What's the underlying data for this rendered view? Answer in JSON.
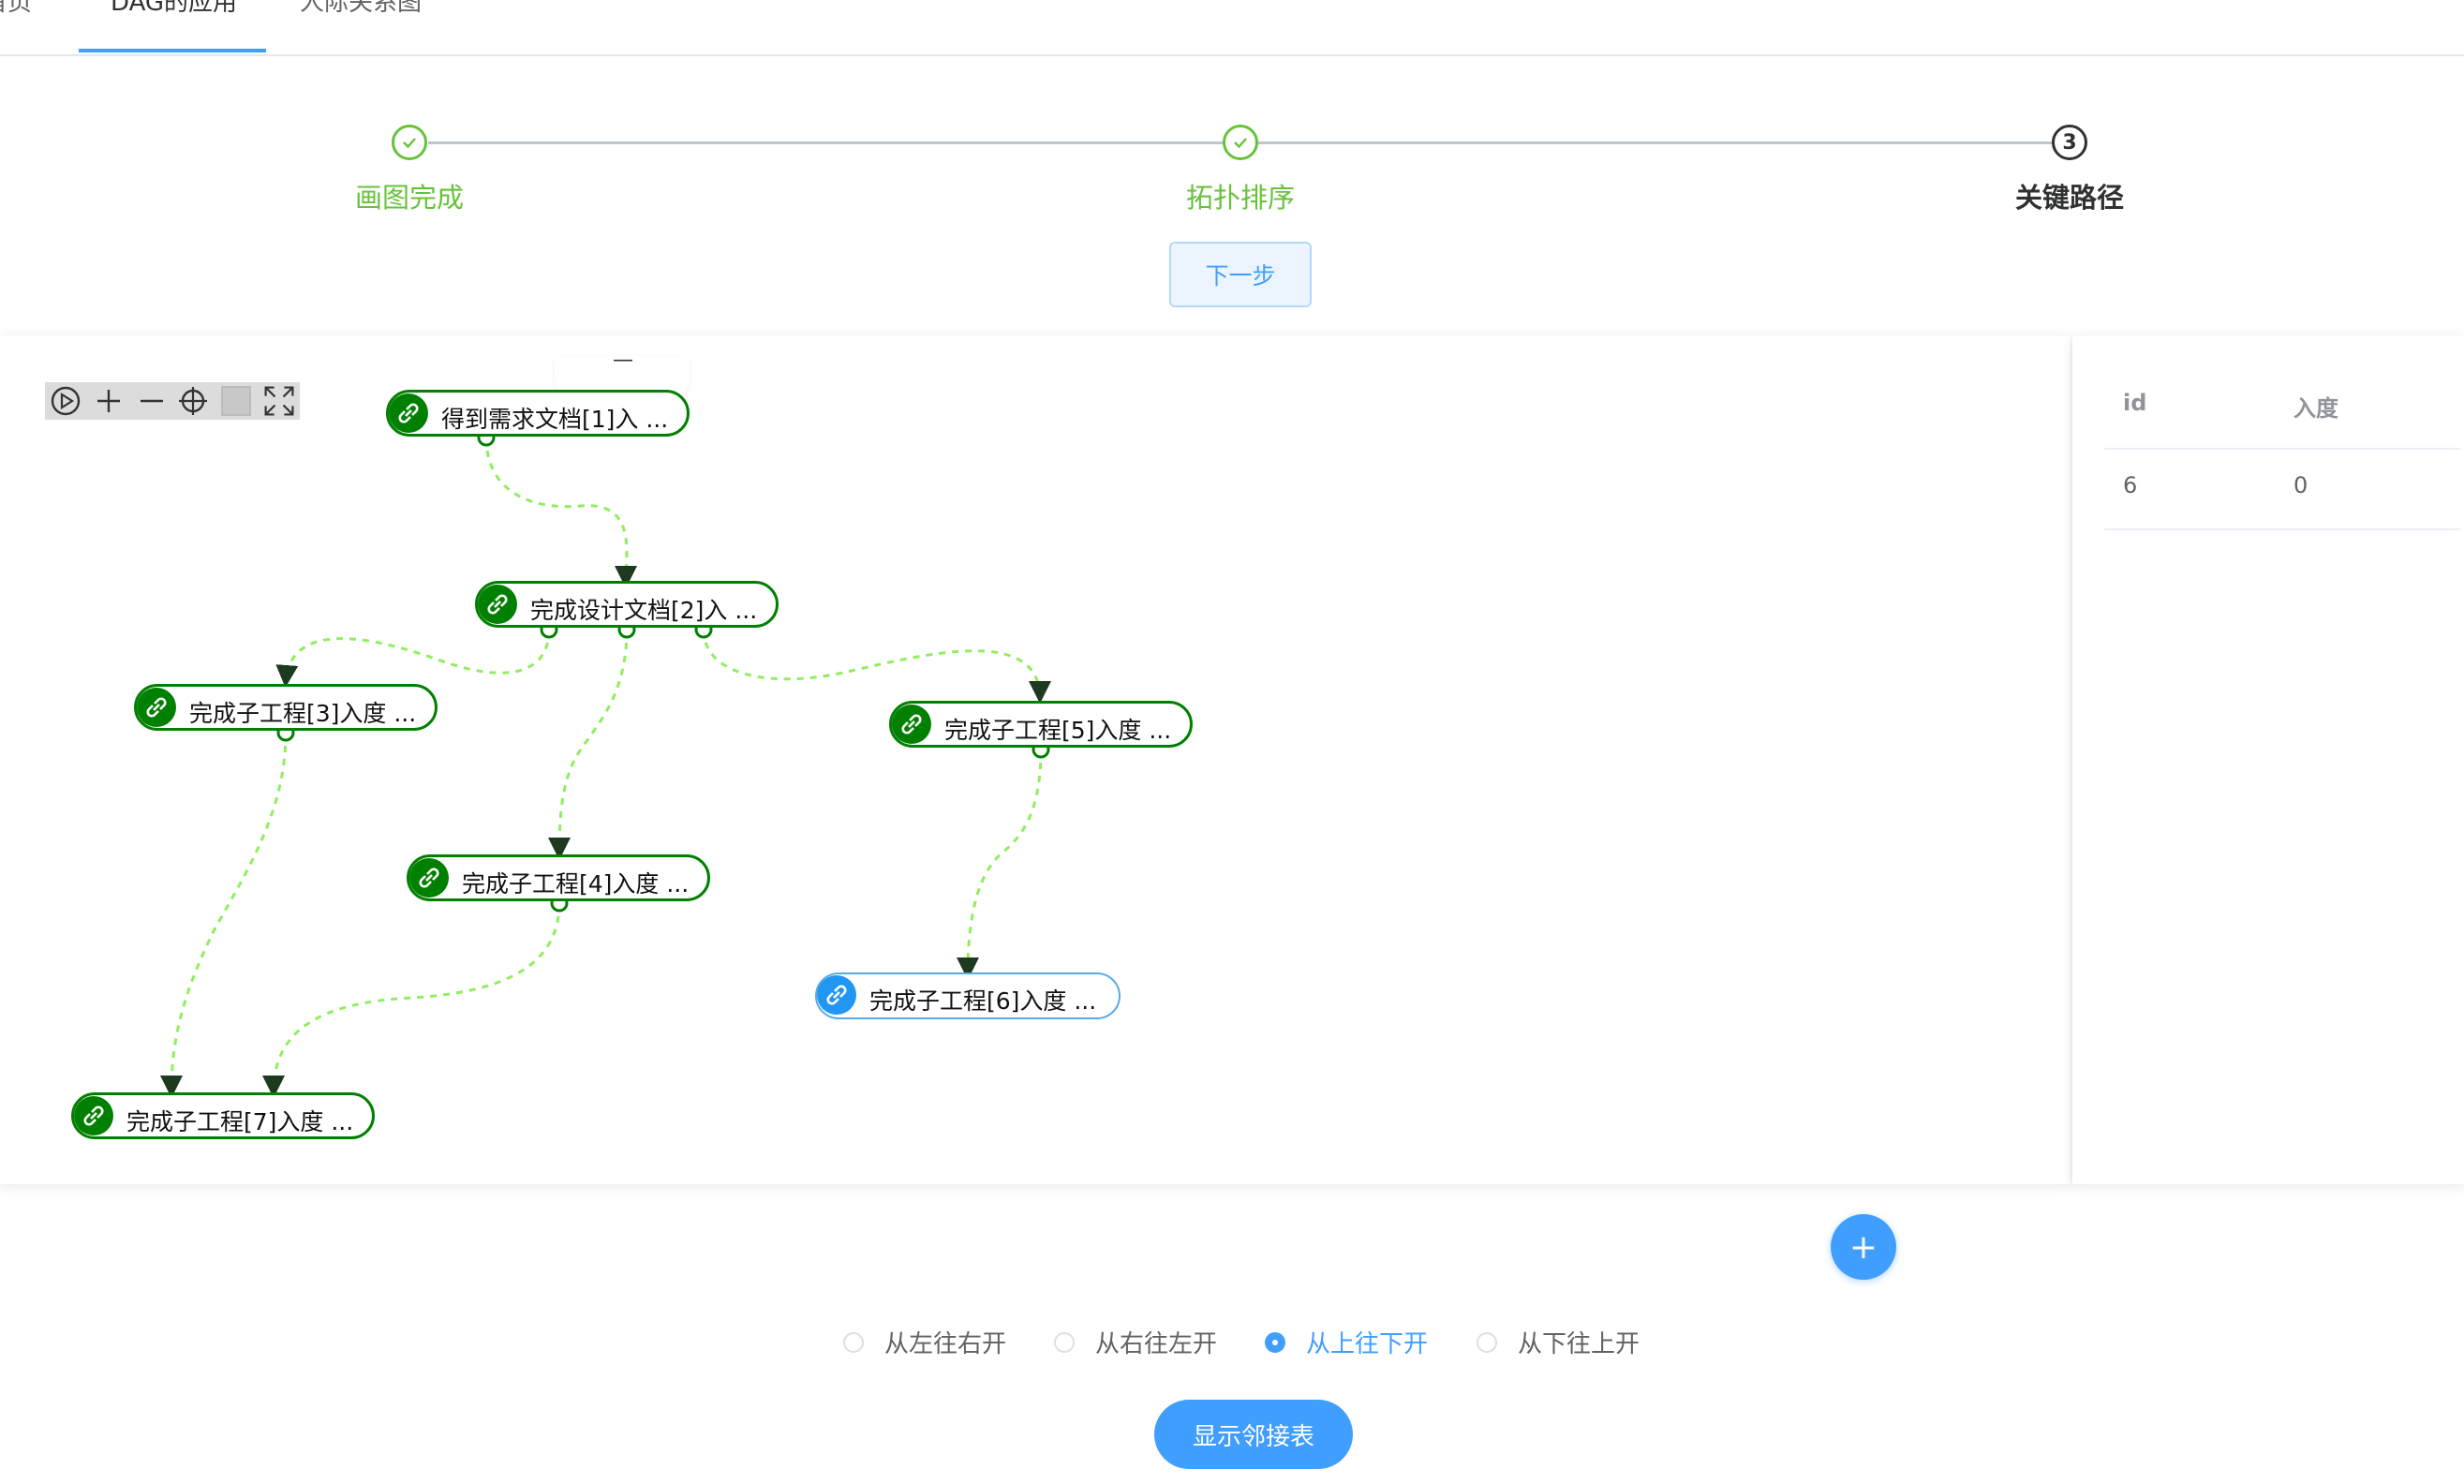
{
  "tabs": [
    {
      "label": "首页",
      "active": false
    },
    {
      "label": "DAG的应用",
      "active": true
    },
    {
      "label": "人际关系图",
      "active": false
    }
  ],
  "steps": [
    {
      "title": "画图完成",
      "status": "done",
      "icon": "check-icon"
    },
    {
      "title": "拓扑排序",
      "status": "done",
      "icon": "check-icon"
    },
    {
      "title": "关键路径",
      "status": "active",
      "number": "3"
    }
  ],
  "next_button": {
    "label": "下一步"
  },
  "toolbar": {
    "icons": [
      "play-icon",
      "zoom-in-icon",
      "zoom-out-icon",
      "locate-icon",
      "square-icon",
      "fullscreen-icon"
    ]
  },
  "graph": {
    "tooltip_text": "—",
    "nodes": [
      {
        "id": "1",
        "label": "得到需求文档[1]入 ...",
        "state": "done",
        "icon": "link-icon"
      },
      {
        "id": "2",
        "label": "完成设计文档[2]入 ...",
        "state": "done",
        "icon": "link-icon"
      },
      {
        "id": "3",
        "label": "完成子工程[3]入度 ...",
        "state": "done",
        "icon": "link-icon"
      },
      {
        "id": "4",
        "label": "完成子工程[4]入度 ...",
        "state": "done",
        "icon": "link-icon"
      },
      {
        "id": "5",
        "label": "完成子工程[5]入度 ...",
        "state": "done",
        "icon": "link-icon"
      },
      {
        "id": "6",
        "label": "完成子工程[6]入度 ...",
        "state": "current",
        "icon": "link-icon"
      },
      {
        "id": "7",
        "label": "完成子工程[7]入度 ...",
        "state": "done",
        "icon": "link-icon"
      }
    ],
    "edges": [
      [
        "1",
        "2"
      ],
      [
        "2",
        "3"
      ],
      [
        "2",
        "4"
      ],
      [
        "2",
        "5"
      ],
      [
        "3",
        "7"
      ],
      [
        "4",
        "7"
      ],
      [
        "5",
        "6"
      ]
    ],
    "colors": {
      "done": "#008000",
      "current": "#2196f3",
      "edge": "#90ee60"
    }
  },
  "table": {
    "headers": [
      "id",
      "入度"
    ],
    "rows": [
      [
        "6",
        "0"
      ]
    ]
  },
  "fab": {
    "icon": "plus-icon",
    "label": "+"
  },
  "layout_options": {
    "options": [
      "从左往右开",
      "从右往左开",
      "从上往下开",
      "从下往上开"
    ],
    "selected": "从上往下开"
  },
  "show_adjacency_button": {
    "label": "显示邻接表"
  },
  "theme": {
    "primary": "#409eff",
    "success": "#67c23a"
  }
}
